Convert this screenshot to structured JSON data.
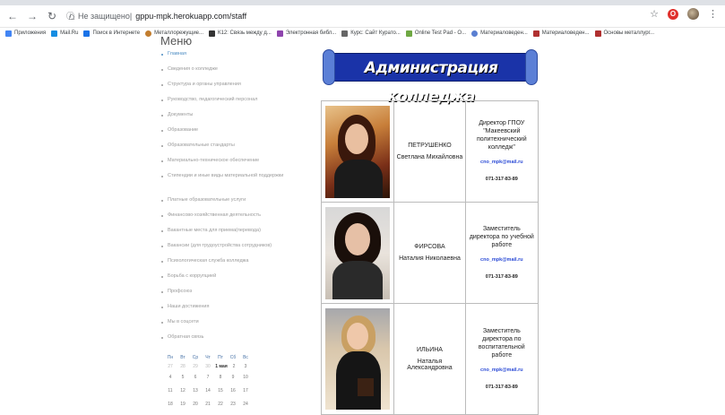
{
  "browser": {
    "url_prefix": "Не защищено",
    "url": "gppu-mpk.herokuapp.com/staff",
    "bookmarks": [
      "Приложения",
      "Mail.Ru",
      "Поиск в Интернете",
      "Металлорежущие...",
      "К12: Связь между д...",
      "Электронная библ...",
      "Курс: Сайт Курато...",
      "Online Test Pad - О...",
      "Материаловеден...",
      "Материаловеден...",
      "Основы металлург..."
    ]
  },
  "sidebar": {
    "title": "Меню",
    "items": [
      "Главная",
      "Сведения о колледже",
      "Структура и органы управления",
      "Руководство, педагогический персонал",
      "Документы",
      "Образование",
      "Образовательные стандарты",
      "Материально-техническое обеспечение",
      "Стипендии и иные виды материальной поддержки",
      "Платные образовательные услуги",
      "Финансово-хозяйственная деятельность",
      "Вакантные места для приема(перевода)",
      "Вакансии (для трудоустройства сотрудников)",
      "Психологическая служба колледжа",
      "Борьба с коррупцией",
      "Профсоюз",
      "Наши достижения",
      "Мы в соцсети",
      "Обратная связь"
    ]
  },
  "calendar": {
    "weekdays": [
      "Пн",
      "Вт",
      "Ср",
      "Чт",
      "Пт",
      "Сб",
      "Вс"
    ],
    "row1": [
      "27",
      "28",
      "29",
      "30",
      "1 мая",
      "2",
      "3"
    ],
    "row2": [
      "4",
      "5",
      "6",
      "7",
      "8",
      "9",
      "10"
    ],
    "row3": [
      "11",
      "12",
      "13",
      "14",
      "15",
      "16",
      "17"
    ],
    "row4": [
      "18",
      "19",
      "20",
      "21",
      "22",
      "23",
      "24"
    ]
  },
  "banner": {
    "title": "Администрация колледжа"
  },
  "staff": [
    {
      "surname": "ПЕТРУШЕНКО",
      "name": "Светлана Михайловна",
      "post": "Директор ГПОУ \"Макеевский политехнический колледж\"",
      "email": "cno_mpk@mail.ru",
      "phone": "071-317-83-89"
    },
    {
      "surname": "ФИРСОВА",
      "name": "Наталия Николаевна",
      "post": "Заместитель директора по учебной работе",
      "email": "cno_mpk@mail.ru",
      "phone": "071-317-83-89"
    },
    {
      "surname": "ИЛЬИНА",
      "name": "Наталья Александровна",
      "post": "Заместитель директора по воспитательной работе",
      "email": "cno_mpk@mail.ru",
      "phone": "071-317-83-89"
    }
  ],
  "colors": {
    "accent": "#4a8bc2",
    "banner": "#1a33a8",
    "email": "#2b4bd6"
  }
}
